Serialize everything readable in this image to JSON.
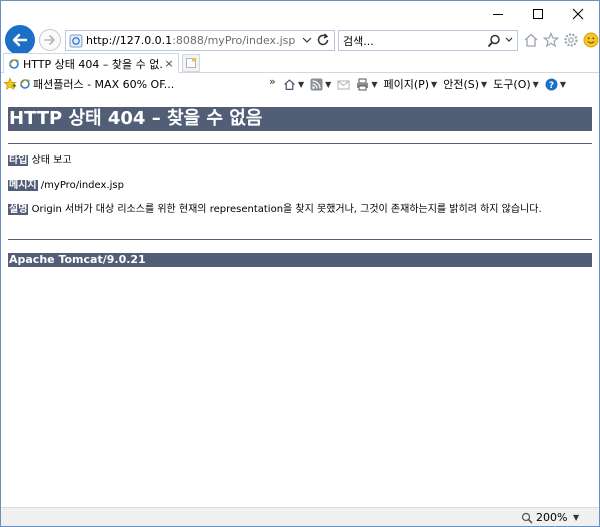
{
  "browser": {
    "address": {
      "url_host": "http://127.0.0.1",
      "url_path": ":8088/myPro/index.jsp"
    },
    "search": {
      "placeholder": "검색..."
    },
    "tab": {
      "title": "HTTP 상태 404 – 찾을 수 없...",
      "close": "×"
    },
    "favorites": {
      "item": "패션플러스 - MAX 60% OF..."
    },
    "commands": {
      "page": "페이지(P)",
      "safety": "안전(S)",
      "tools": "도구(O)"
    },
    "chevron": "»",
    "status": {
      "zoom": "200%"
    },
    "accent": "#1c6fc6"
  },
  "page": {
    "title": "HTTP 상태 404 – 찾을 수 없음",
    "type_label": "타입",
    "type_value": "상태 보고",
    "message_label": "메시지",
    "message_value": "/myPro/index.jsp",
    "description_label": "설명",
    "description_value": "Origin 서버가 대상 리소스를 위한 현재의 representation을 찾지 못했거나, 그것이 존재하는지를 밝히려 하지 않습니다.",
    "footer": "Apache Tomcat/9.0.21",
    "header_color": "#525d76"
  }
}
